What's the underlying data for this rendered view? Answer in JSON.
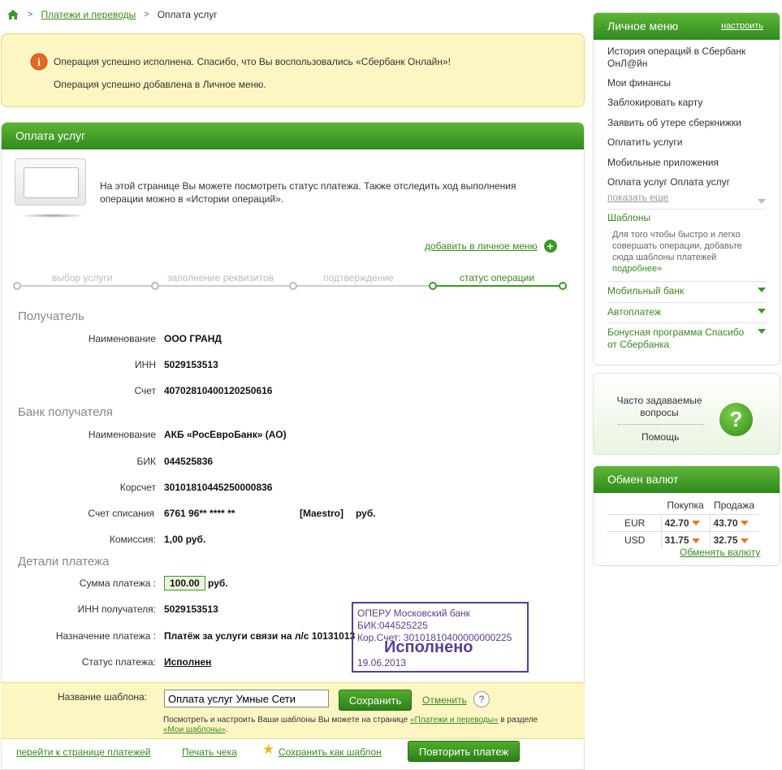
{
  "breadcrumb": {
    "home_icon": "home-icon",
    "link": "Платежи и переводы",
    "current": "Оплата услуг"
  },
  "message": {
    "line1": "Операция успешно исполнена. Спасибо, что Вы воспользовались «Сбербанк Онлайн»!",
    "line2": "Операция успешно добавлена в Личное меню.",
    "icon": "info-icon"
  },
  "panel": {
    "title": "Оплата услуг",
    "intro": "На этой странице Вы можете посмотреть статус платежа. Также отследить ход выполнения операции можно в «Истории операций».",
    "add_to_menu": "добавить в личное меню",
    "steps": [
      "выбор услуги",
      "заполнение реквизитов",
      "подтверждение",
      "статус операции"
    ],
    "active_step": 3
  },
  "recipient": {
    "title": "Получатель",
    "name_label": "Наименование",
    "name": "ООО ГРАНД",
    "inn_label": "ИНН",
    "inn": "5029153513",
    "account_label": "Счет",
    "account": "40702810400120250616"
  },
  "bank": {
    "title": "Банк получателя",
    "name_label": "Наименование",
    "name": "АКБ «РосЕвроБанк» (АО)",
    "bik_label": "БИК",
    "bik": "044525836",
    "corr_label": "Корсчет",
    "corr": "30101810445250000836",
    "debit_label": "Счет списания",
    "debit": "6761 96** **** **",
    "debit_type": "[Maestro]",
    "debit_cur": "руб.",
    "fee_label": "Комиссия:",
    "fee": "1,00 руб."
  },
  "details": {
    "title": "Детали платежа",
    "sum_label": "Сумма платежа :",
    "sum": "100.00",
    "sum_cur": "руб.",
    "inn_label": "ИНН получателя:",
    "inn": "5029153513",
    "purpose_label": "Назначение платежа :",
    "purpose": "Платёж за услуги связи на л/с 10131013",
    "status_label": "Статус платежа:",
    "status": "Исполнен"
  },
  "stamp": {
    "line1": "ОПЕРУ Московский банк",
    "line2": "БИК:044525225",
    "line3": "Кор.Счет: 30101810400000000225",
    "big": "Исполнено",
    "date": "19.06.2013"
  },
  "template": {
    "label": "Название шаблона:",
    "value": "Оплата услуг Умные Сети",
    "save": "Сохранить",
    "cancel": "Отменить",
    "help": "?",
    "note_pre": "Посмотреть и настроить Ваши шаблоны Вы можете на странице ",
    "note_link1": "«Платежи и переводы»",
    "note_mid": " в разделе ",
    "note_link2": "«Мои шаблоны»",
    "note_end": "."
  },
  "footer": {
    "to_payments": "перейти к странице платежей",
    "print": "Печать чека",
    "save_template": "Сохранить как шаблон",
    "repeat": "Повторить платеж"
  },
  "sidebar": {
    "title": "Личное меню",
    "settings": "настроить",
    "items": [
      "История операций в Сбербанк ОнЛ@йн",
      "Мои финансы",
      "Заблокировать карту",
      "Заявить об утере сберкнижки",
      "Оплатить услуги",
      "Мобильные приложения",
      "Оплата услуг Оплата услуг"
    ],
    "show_more": "показать еще",
    "templates": "Шаблоны",
    "templates_note": "Для того чтобы быстро и легко совершать операции, добавьте сюда шаблоны платежей ",
    "templates_more": "подробнее»",
    "mobile_bank": "Мобильный банк",
    "autopay": "Автоплатеж",
    "bonus": "Бонусная программа Спасибо от Сбербанка"
  },
  "faq": {
    "title": "Часто задаваемые вопросы",
    "help": "Помощь",
    "icon": "question-icon"
  },
  "fx": {
    "title": "Обмен валют",
    "buy": "Покупка",
    "sell": "Продажа",
    "rows": [
      {
        "cur": "EUR",
        "buy": "42.70",
        "sell": "43.70"
      },
      {
        "cur": "USD",
        "buy": "31.75",
        "sell": "32.75"
      }
    ],
    "change": "Обменять валюту"
  }
}
